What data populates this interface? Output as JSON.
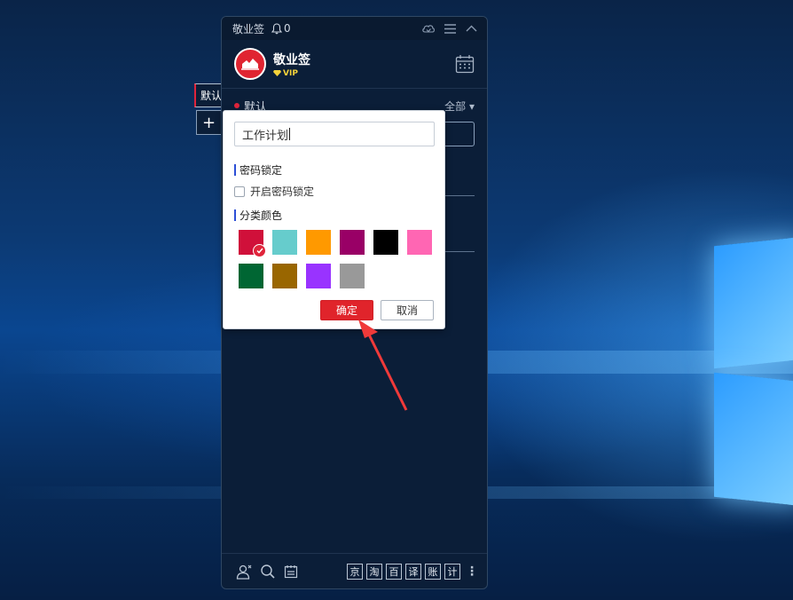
{
  "app": {
    "title": "敬业签",
    "notification_count": "0",
    "user": {
      "name": "敬业签",
      "badge": "VIP"
    },
    "category": {
      "current": "默认",
      "filter_label": "全部"
    },
    "side_tab_label": "默认",
    "side_add_label": "+",
    "toolbar_chars": [
      "京",
      "淘",
      "百",
      "译",
      "账",
      "计"
    ]
  },
  "dialog": {
    "name_value": "工作计划",
    "password_section": "密码锁定",
    "password_checkbox_label": "开启密码锁定",
    "password_checked": false,
    "color_section": "分类颜色",
    "colors": [
      "#d0103a",
      "#66cccc",
      "#ff9900",
      "#990066",
      "#000000",
      "#ff66b3",
      "#006633",
      "#996600",
      "#9933ff",
      "#999999"
    ],
    "selected_color_index": 0,
    "confirm_label": "确定",
    "cancel_label": "取消"
  },
  "icons": {
    "bell": "bell-icon",
    "cloud": "cloud-sync-icon",
    "menu": "menu-icon",
    "collapse": "chevron-up-icon",
    "calendar": "calendar-icon",
    "contacts": "contacts-icon",
    "search": "search-icon",
    "notes": "notes-icon"
  },
  "accent_colors": {
    "brand_red": "#e0242b",
    "section_bar": "#2d4fd6",
    "window_bg": "#0b1e38"
  }
}
